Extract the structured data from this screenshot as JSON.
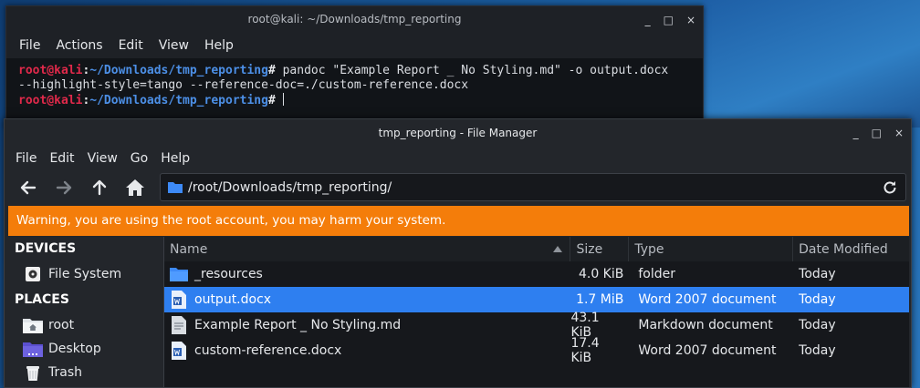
{
  "terminal": {
    "title": "root@kali: ~/Downloads/tmp_reporting",
    "menu": [
      "File",
      "Actions",
      "Edit",
      "View",
      "Help"
    ],
    "prompt_user": "root@kali",
    "prompt_path": "~/Downloads/tmp_reporting",
    "prompt_sep": ":",
    "prompt_symbol": "#",
    "command_line1": " pandoc \"Example Report _ No Styling.md\" -o output.docx",
    "command_line2": "--highlight-style=tango --reference-doc=./custom-reference.docx"
  },
  "window_controls": {
    "minimize": "_",
    "maximize": "□",
    "close": "×"
  },
  "file_manager": {
    "title": "tmp_reporting - File Manager",
    "menu": [
      "File",
      "Edit",
      "View",
      "Go",
      "Help"
    ],
    "address": "/root/Downloads/tmp_reporting/",
    "warning": "Warning, you are using the root account, you may harm your system.",
    "sidebar": {
      "devices_heading": "DEVICES",
      "devices": [
        {
          "label": "File System",
          "icon": "hard-drive-icon"
        }
      ],
      "places_heading": "PLACES",
      "places": [
        {
          "label": "root",
          "icon": "home-folder-icon"
        },
        {
          "label": "Desktop",
          "icon": "desktop-folder-icon"
        },
        {
          "label": "Trash",
          "icon": "trash-icon"
        }
      ]
    },
    "columns": {
      "name": "Name",
      "size": "Size",
      "type": "Type",
      "date": "Date Modified"
    },
    "files": [
      {
        "name": "_resources",
        "size": "4.0 KiB",
        "type": "folder",
        "date": "Today",
        "icon": "folder-icon",
        "selected": false
      },
      {
        "name": "output.docx",
        "size": "1.7 MiB",
        "type": "Word 2007 document",
        "date": "Today",
        "icon": "word-doc-icon",
        "selected": true
      },
      {
        "name": "Example Report _ No Styling.md",
        "size": "43.1 KiB",
        "type": "Markdown document",
        "date": "Today",
        "icon": "markdown-file-icon",
        "selected": false
      },
      {
        "name": "custom-reference.docx",
        "size": "17.4 KiB",
        "type": "Word 2007 document",
        "date": "Today",
        "icon": "word-doc-icon",
        "selected": false
      }
    ]
  },
  "colors": {
    "warning": "#f47d0a",
    "selection": "#2e7ff0",
    "prompt_user": "#e0294a",
    "prompt_path": "#4c8fe6"
  }
}
